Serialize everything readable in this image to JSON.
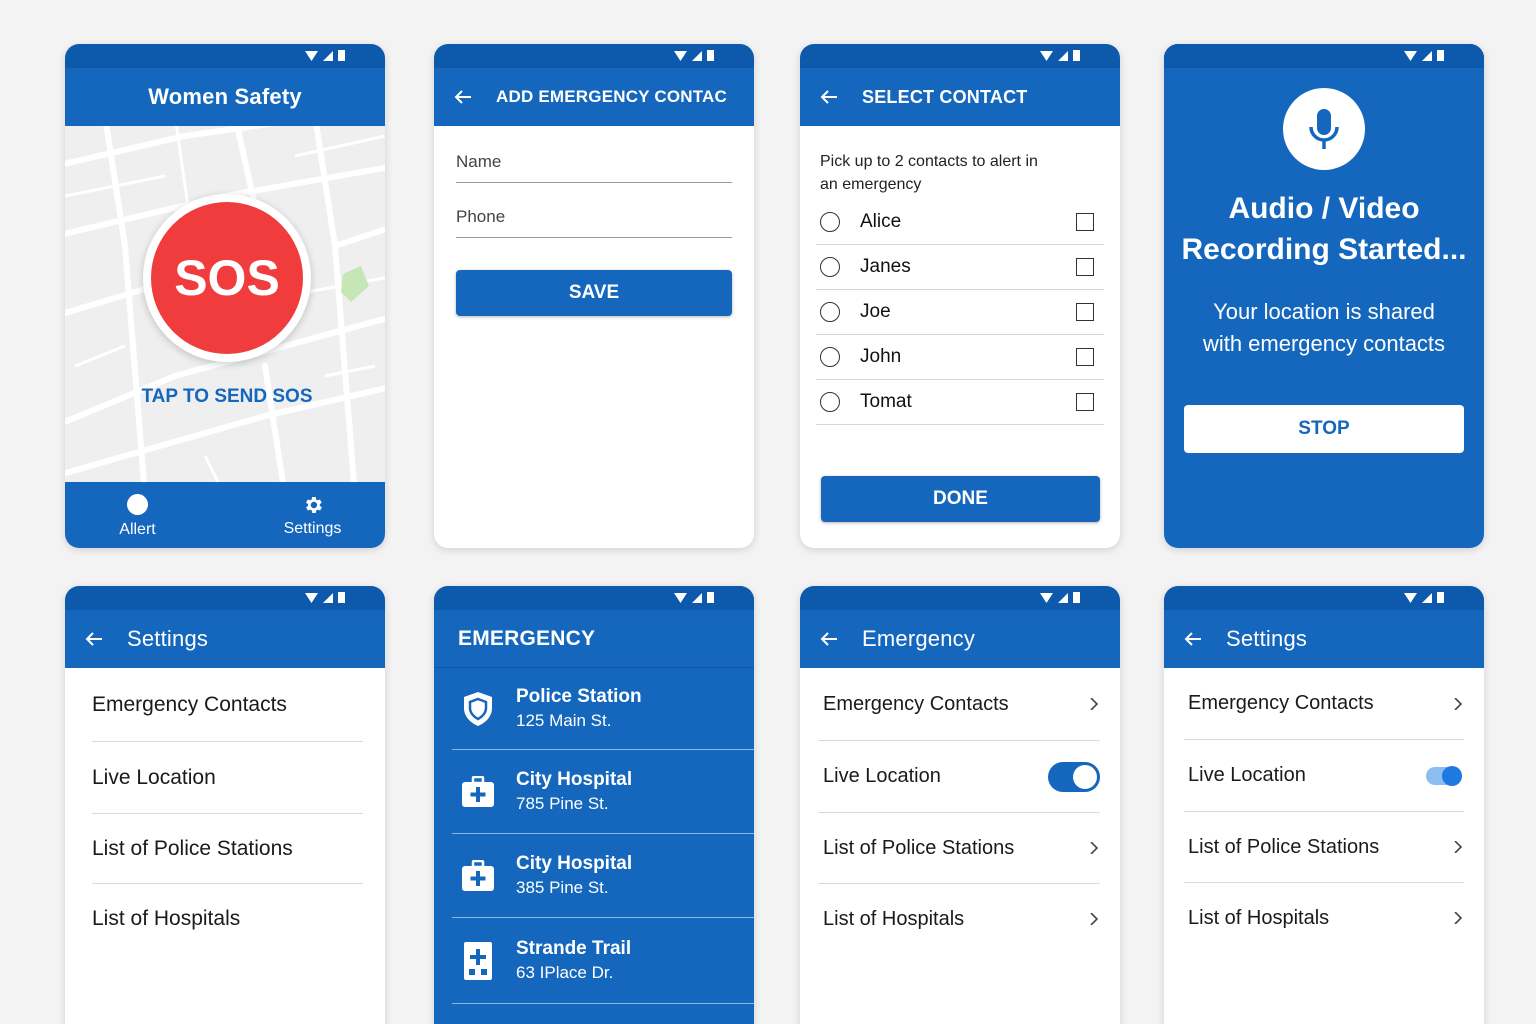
{
  "screen1": {
    "title": "Women Safety",
    "sos_label": "SOS",
    "tap_label": "TAP TO SEND SOS",
    "nav": [
      {
        "label": "Allert",
        "icon": "alert-circle-icon"
      },
      {
        "label": "Settings",
        "icon": "gear-icon"
      }
    ]
  },
  "screen2": {
    "title": "ADD EMERGENCY CONTAC",
    "name_placeholder": "Name",
    "phone_placeholder": "Phone",
    "save_label": "SAVE"
  },
  "screen3": {
    "title": "SELECT CONTACT",
    "instruction": "Pick up to 2 contacts to alert in an emergency",
    "contacts": [
      "Alice",
      "Janes",
      "Joe",
      "John",
      "Tomat"
    ],
    "done_label": "DONE"
  },
  "screen4": {
    "heading": "Audio / Video Recording Started...",
    "message": "Your location is shared with emergency contacts",
    "stop_label": "STOP",
    "icon": "microphone-icon"
  },
  "screen5": {
    "title": "Settings",
    "items": [
      "Emergency Contacts",
      "Live Location",
      "List of Police Stations",
      "List of Hospitals"
    ]
  },
  "screen6": {
    "title": "EMERGENCY",
    "places": [
      {
        "name": "Police Station",
        "address": "125 Main St.",
        "icon": "police-shield-icon"
      },
      {
        "name": "City Hospital",
        "address": "785 Pine St.",
        "icon": "hospital-kit-icon"
      },
      {
        "name": "City Hospital",
        "address": "385 Pine St.",
        "icon": "hospital-kit-icon"
      },
      {
        "name": "Strande Trail",
        "address": "63 IPlace Dr.",
        "icon": "hospital-building-icon"
      }
    ]
  },
  "screen7": {
    "title": "Emergency",
    "items": [
      "Emergency Contacts",
      "Live Location",
      "List of Police Stations",
      "List of Hospitals"
    ],
    "live_location_on": true
  },
  "screen8": {
    "title": "Settings",
    "items": [
      "Emergency Contacts",
      "Live Location",
      "List of Police Stations",
      "List of Hospitals"
    ],
    "live_location_on": true
  },
  "colors": {
    "primary": "#1467bd",
    "status_bar": "#0d5aad",
    "sos_red": "#f03c3c",
    "background": "#f3f3f4"
  }
}
